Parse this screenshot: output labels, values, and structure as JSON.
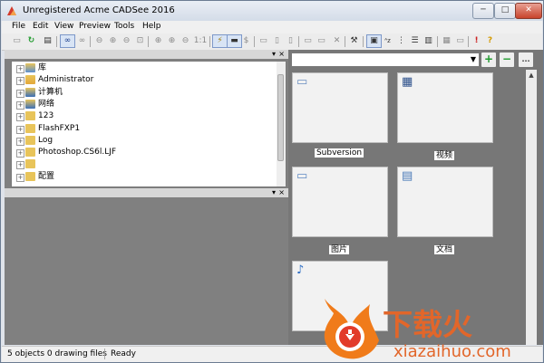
{
  "window": {
    "title": "Unregistered Acme CADSee 2016"
  },
  "menu": [
    "File",
    "Edit",
    "View",
    "Preview",
    "Tools",
    "Help"
  ],
  "toolbar": {
    "icons": [
      "open-folder",
      "refresh",
      "film",
      "link-view",
      "link-view-2",
      "zoom-out",
      "zoom-in",
      "zoom-out-2",
      "zoom-fit",
      "pan-left",
      "zoom-window",
      "zoom-prev",
      "zoom-actual",
      "pick",
      "view-mode",
      "dollar",
      "layers",
      "properties",
      "copy",
      "paste",
      "delete",
      "tools",
      "abc-sort",
      "tree-view",
      "list-view",
      "columns",
      "grid-view",
      "film-strip",
      "help-exclaim",
      "help-question"
    ],
    "zoom_label": "1:1",
    "dollar_label": "$"
  },
  "tree": {
    "items": [
      {
        "label": "库",
        "icon": "library-icon",
        "icon_color": "#5b8fcf"
      },
      {
        "label": "Administrator",
        "icon": "user-icon",
        "icon_color": "#e3a83a"
      },
      {
        "label": "计算机",
        "icon": "computer-icon",
        "icon_color": "#3a6fb8"
      },
      {
        "label": "网络",
        "icon": "network-icon",
        "icon_color": "#3a6fb8"
      },
      {
        "label": "123",
        "icon": "folder-icon",
        "icon_color": "#e8c45a"
      },
      {
        "label": "FlashFXP1",
        "icon": "folder-icon",
        "icon_color": "#e8c45a"
      },
      {
        "label": "Log",
        "icon": "folder-icon",
        "icon_color": "#e8c45a"
      },
      {
        "label": "Photoshop.CS6l.LJF",
        "icon": "folder-icon",
        "icon_color": "#e8c45a"
      },
      {
        "label": "",
        "icon": "folder-icon",
        "icon_color": "#e8c45a"
      },
      {
        "label": "配置",
        "icon": "folder-icon",
        "icon_color": "#e8c45a"
      }
    ]
  },
  "right": {
    "path_value": "",
    "add_label": "+",
    "remove_label": "−",
    "more_label": "...",
    "items": [
      {
        "caption": "Subversion",
        "icon": "disk-icon"
      },
      {
        "caption": "视频",
        "icon": "video-icon"
      },
      {
        "caption": "图片",
        "icon": "picture-icon"
      },
      {
        "caption": "文档",
        "icon": "document-icon"
      },
      {
        "caption": "",
        "icon": "music-icon"
      }
    ]
  },
  "status": {
    "objects": "5 objects 0 drawing files",
    "state": "Ready"
  },
  "watermark": {
    "brand": "下载火",
    "site": "xiazaihuo.com"
  },
  "colors": {
    "accent_green": "#1e9a2c",
    "watermark_orange": "#f07b1a",
    "folder_yellow": "#e8c45a"
  }
}
